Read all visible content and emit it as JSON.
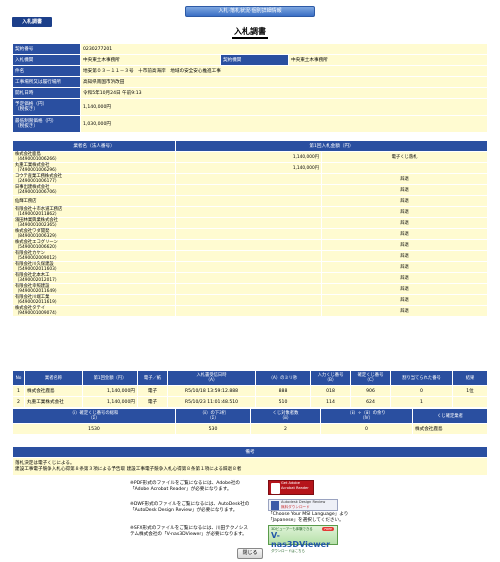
{
  "header": {
    "topbar": "入札·落札状況·個別詳細情報",
    "tab": "入札調書",
    "title": "入札調書"
  },
  "info": {
    "contract_no": {
      "label": "契約番号",
      "value": "0230277201"
    },
    "bid_org": {
      "label": "入札機関",
      "value": "中央東土木事務所"
    },
    "contract_org": {
      "label": "契約機関",
      "value": "中央東土木事務所"
    },
    "case_name": {
      "label": "件名",
      "value": "地安第０３－１１－３号　十市前高海岸　地域の安全安心推進工事"
    },
    "location": {
      "label": "工事場所又は履行場所",
      "value": "高知県南国市浜改田"
    },
    "opening_date": {
      "label": "開札日時",
      "value": "令和5年10月24日 午前9:13"
    },
    "planned_price": {
      "label": "予定価格（円）\n（税抜き）",
      "value": "1,140,000円"
    },
    "min_price": {
      "label": "最低制限価格（円）\n（税抜き）",
      "value": "1,030,000円"
    }
  },
  "bid_table": {
    "headers": [
      "業者名（法人番号）",
      "第1回入札金額（円）"
    ],
    "rows": [
      {
        "name": "株式会社鹿島",
        "corp": "（4490001006266）",
        "amount": "1,140,000円",
        "status": "電子くじ落札"
      },
      {
        "name": "丸重工業株式会社",
        "corp": "（7490001006296）",
        "amount": "1,140,000円",
        "status": ""
      },
      {
        "name": "コウテ産業工務株式会社",
        "corp": "（2490001006177）",
        "amount": "",
        "status": "辞退"
      },
      {
        "name": "日事出建株式会社",
        "corp": "（2490001006706）",
        "amount": "",
        "status": "辞退"
      },
      {
        "name": "仙輝工務店",
        "corp": "",
        "amount": "",
        "status": "辞退"
      },
      {
        "name": "有限会社十市水道工務店",
        "corp": "（1490002011862）",
        "amount": "",
        "status": "辞退"
      },
      {
        "name": "濱田林業興業株式会社",
        "corp": "（3490001002365）",
        "amount": "",
        "status": "辞退"
      },
      {
        "name": "株式会社ワダ開発",
        "corp": "（8490001006329）",
        "amount": "",
        "status": "辞退"
      },
      {
        "name": "株式会社エコグリーン",
        "corp": "（5490001006620）",
        "amount": "",
        "status": "辞退"
      },
      {
        "name": "有限会社カケン",
        "corp": "（5490002009012）",
        "amount": "",
        "status": "辞退"
      },
      {
        "name": "有限会社川久保建設",
        "corp": "（5490002011603）",
        "amount": "",
        "status": "辞退"
      },
      {
        "name": "有限会社北本木工",
        "corp": "（3490002012017）",
        "amount": "",
        "status": "辞退"
      },
      {
        "name": "有限会社幸照建設",
        "corp": "（9490002011649）",
        "amount": "",
        "status": "辞退"
      },
      {
        "name": "有限会社川端工業",
        "corp": "（6490002011619）",
        "amount": "",
        "status": "辞退"
      },
      {
        "name": "株式会社タテイ",
        "corp": "（9490001009074）",
        "amount": "",
        "status": "辞退"
      }
    ]
  },
  "result_table": {
    "headers": [
      "No",
      "業者名称",
      "第1回金額（円）",
      "電子／紙",
      "入札書受信日時\n（A）",
      "（A）のミリ秒",
      "入力くじ番号\n（B）",
      "確定くじ番号\n（C）",
      "割り当てられた番号",
      "結果"
    ],
    "rows": [
      [
        "1",
        "株式会社鹿島",
        "1,140,000円",
        "電子",
        "R5/10/18 13:59:12.888",
        "888",
        "018",
        "906",
        "0",
        "1位"
      ],
      [
        "2",
        "丸重工業株式会社",
        "1,140,000円",
        "電子",
        "R5/10/23 11:01:48.510",
        "510",
        "114",
        "624",
        "1",
        ""
      ]
    ]
  },
  "count_table": {
    "headers": [
      "（ⅰ）確定くじ番号の総和\n（Σ）",
      "（ⅱ）の下3桁\n（Σ）",
      "くじ対象者数\n（ⅲ）",
      "（ⅱ）÷（ⅲ）の余り\n（Ⅳ）",
      "くじ確定業者"
    ],
    "values": [
      "1530",
      "530",
      "2",
      "0",
      "株式会社鹿島"
    ]
  },
  "notes": {
    "header": "備考",
    "lines": [
      "落札決定は電子くじによる。",
      "建設工事電子競争入札心得第８条第３項による予告取 建設工事電子競争入札心得第８条第１項による辞退８者"
    ]
  },
  "viewers": {
    "pdf_text": [
      "※PDF形式のファイルをご覧になるには、Adobe社の",
      "「Adobe Acrobat Reader」が必要になります。"
    ],
    "dwf_text": [
      "※DWF形式のファイルをご覧になるには、AutoDesk社の",
      "「AutoDesk Design Review」が必要になります。"
    ],
    "dwf_text2": [
      "「Choose Your MSI Language」より",
      "「Japanese」を選択してください。"
    ],
    "sfx_text": [
      "※SFX形式のファイルをご覧になるには、川田テクノシス",
      "テム株式会社の「V-nas3DViewer」が必要になります。"
    ],
    "logo_adobe": [
      "Get Adobe",
      "Acrobat Reader"
    ],
    "logo_autodesk": [
      "Autodesk Design Review",
      "無料ダウンロード"
    ],
    "logo_vnas": [
      "3Dビューアーも体験できる",
      "V-nas3DViewer",
      "ダウンロードはこちら",
      "FREE"
    ]
  },
  "footer": {
    "close_label": "閉じる"
  }
}
